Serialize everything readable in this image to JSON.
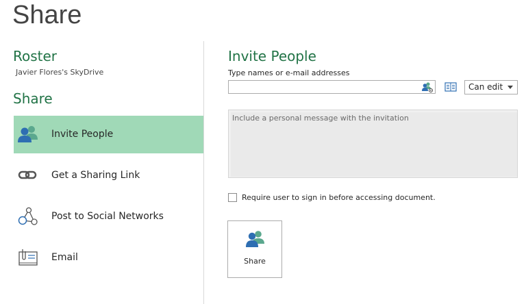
{
  "page": {
    "title": "Share"
  },
  "document": {
    "name": "Roster",
    "location": "Javier Flores's SkyDrive"
  },
  "left_nav": {
    "heading": "Share",
    "items": [
      {
        "label": "Invite People",
        "icon": "invite-people-icon",
        "selected": true
      },
      {
        "label": "Get a Sharing Link",
        "icon": "link-icon",
        "selected": false
      },
      {
        "label": "Post to Social Networks",
        "icon": "social-network-icon",
        "selected": false
      },
      {
        "label": "Email",
        "icon": "email-icon",
        "selected": false
      }
    ]
  },
  "invite": {
    "title": "Invite People",
    "names_label": "Type names or e-mail addresses",
    "names_value": "",
    "permission": {
      "selected": "Can edit"
    },
    "message_placeholder": "Include a personal message with the invitation",
    "require_signin": {
      "label": "Require user to sign in before accessing document.",
      "checked": false
    },
    "share_button_label": "Share"
  },
  "colors": {
    "accent_green": "#217346",
    "selected_bg": "#a0d9b7",
    "people_blue": "#2e6eb2",
    "people_teal": "#5ba88e"
  }
}
